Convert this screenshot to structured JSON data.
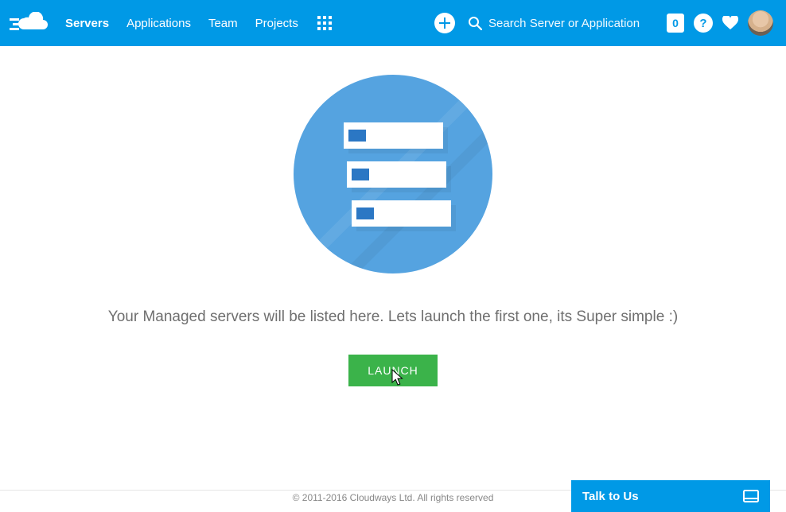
{
  "header": {
    "nav": {
      "servers": "Servers",
      "applications": "Applications",
      "team": "Team",
      "projects": "Projects"
    },
    "search_placeholder": "Search Server or Application",
    "notif_count": "0"
  },
  "main": {
    "empty_text": "Your Managed servers will be listed here. Lets launch the first one, its Super simple :)",
    "launch_label": "LAUNCH"
  },
  "footer": {
    "copyright": "© 2011-2016 Cloudways Ltd. All rights reserved"
  },
  "chat": {
    "label": "Talk to Us"
  }
}
